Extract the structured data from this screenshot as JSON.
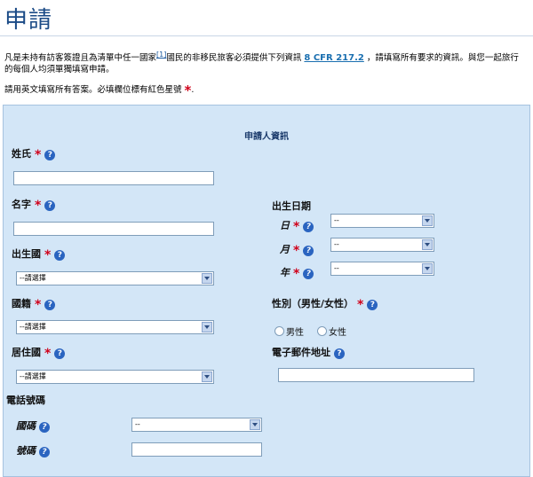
{
  "page": {
    "title": "申請",
    "intro_text_1": "凡是未持有訪客簽證且為清單中任一國家",
    "footnote_link": "[1]",
    "intro_text_2": "國民的非移民旅客必須提供下列資訊",
    "cfr_link": "8 CFR 217.2",
    "intro_text_3": "，請填寫所有要求的資訊。與您一起旅行的每個人均須單獨填寫申請。",
    "note_text": "請用英文填寫所有答案。必填欄位標有紅色星號",
    "required_mark": "*"
  },
  "form": {
    "section_title": "申請人資訊",
    "help_glyph": "?",
    "surname": {
      "label": "姓氏",
      "value": ""
    },
    "given_name": {
      "label": "名字",
      "value": ""
    },
    "country_of_birth": {
      "label": "出生國",
      "selected": "--請選擇"
    },
    "nationality": {
      "label": "國籍",
      "selected": "--請選擇"
    },
    "country_of_residence": {
      "label": "居住國",
      "selected": "--請選擇"
    },
    "phone": {
      "label": "電話號碼",
      "country_code_label": "國碼",
      "country_code_selected": "--",
      "number_label": "號碼",
      "number_value": ""
    },
    "birth_date": {
      "label": "出生日期",
      "day_label": "日",
      "day_selected": "--",
      "month_label": "月",
      "month_selected": "--",
      "year_label": "年",
      "year_selected": "--"
    },
    "gender": {
      "label": "性別（男性/女性）",
      "male": "男性",
      "female": "女性"
    },
    "email": {
      "label": "電子郵件地址",
      "value": ""
    }
  }
}
